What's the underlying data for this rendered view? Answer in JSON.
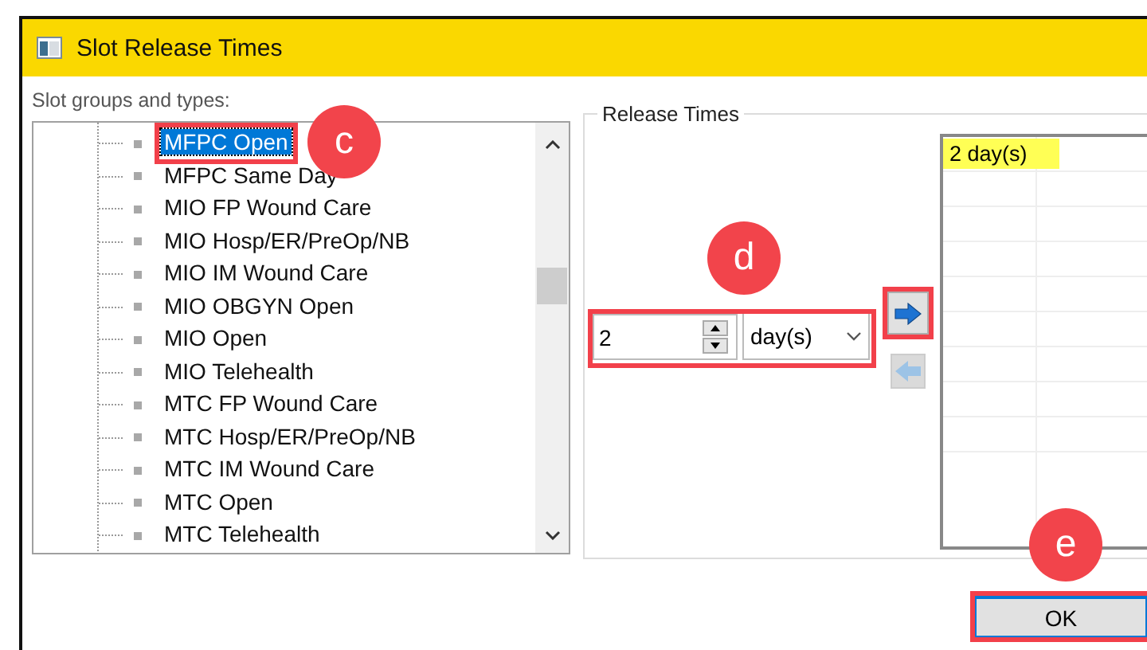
{
  "window": {
    "title": "Slot Release Times"
  },
  "tree": {
    "label": "Slot groups and types:",
    "items": [
      {
        "label": "MFPC Open",
        "selected": true,
        "highlighted": true
      },
      {
        "label": "MFPC Same Day",
        "selected": false,
        "highlighted": false
      },
      {
        "label": "MIO FP Wound Care",
        "selected": false,
        "highlighted": false
      },
      {
        "label": "MIO Hosp/ER/PreOp/NB",
        "selected": false,
        "highlighted": false
      },
      {
        "label": "MIO IM Wound Care",
        "selected": false,
        "highlighted": false
      },
      {
        "label": "MIO OBGYN Open",
        "selected": false,
        "highlighted": false
      },
      {
        "label": "MIO Open",
        "selected": false,
        "highlighted": false
      },
      {
        "label": "MIO Telehealth",
        "selected": false,
        "highlighted": false
      },
      {
        "label": "MTC FP Wound Care",
        "selected": false,
        "highlighted": false
      },
      {
        "label": "MTC Hosp/ER/PreOp/NB",
        "selected": false,
        "highlighted": false
      },
      {
        "label": "MTC IM Wound Care",
        "selected": false,
        "highlighted": false
      },
      {
        "label": "MTC Open",
        "selected": false,
        "highlighted": false
      },
      {
        "label": "MTC Telehealth",
        "selected": false,
        "highlighted": false
      }
    ]
  },
  "release_times": {
    "title": "Release Times",
    "value": "2",
    "unit": "day(s)",
    "controls_highlighted": true,
    "add_button": {
      "highlighted": true,
      "disabled": false
    },
    "remove_button": {
      "highlighted": false,
      "disabled": true
    },
    "list": [
      {
        "text": "2 day(s)",
        "marked": true
      }
    ]
  },
  "ok_button": {
    "label": "OK",
    "highlighted": true
  },
  "callouts": [
    {
      "label": "c"
    },
    {
      "label": "d"
    },
    {
      "label": "e"
    }
  ]
}
